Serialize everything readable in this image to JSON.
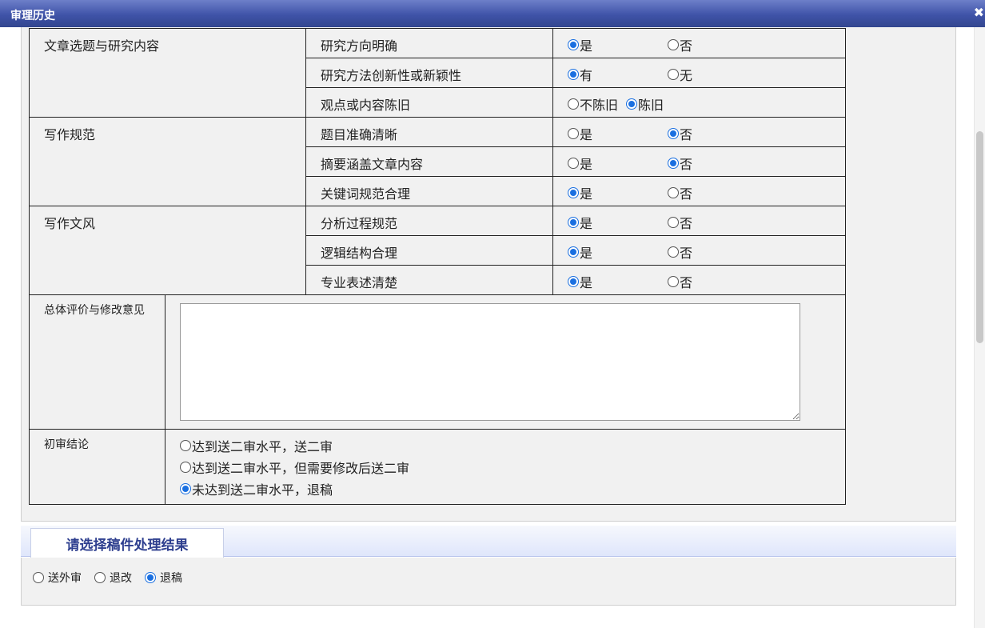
{
  "window": {
    "title": "审理历史",
    "close_glyph": "✖"
  },
  "review_table": {
    "groups": [
      {
        "category": "文章选题与研究内容",
        "rows": [
          {
            "criterion": "研究方向明确",
            "options": [
              "是",
              "否"
            ],
            "selected": 0
          },
          {
            "criterion": "研究方法创新性或新颖性",
            "options": [
              "有",
              "无"
            ],
            "selected": 0
          },
          {
            "criterion": "观点或内容陈旧",
            "options": [
              "不陈旧",
              "陈旧"
            ],
            "selected": 1
          }
        ]
      },
      {
        "category": "写作规范",
        "rows": [
          {
            "criterion": "题目准确清晰",
            "options": [
              "是",
              "否"
            ],
            "selected": 1
          },
          {
            "criterion": "摘要涵盖文章内容",
            "options": [
              "是",
              "否"
            ],
            "selected": 1
          },
          {
            "criterion": "关键词规范合理",
            "options": [
              "是",
              "否"
            ],
            "selected": 0
          }
        ]
      },
      {
        "category": "写作文风",
        "rows": [
          {
            "criterion": "分析过程规范",
            "options": [
              "是",
              "否"
            ],
            "selected": 0
          },
          {
            "criterion": "逻辑结构合理",
            "options": [
              "是",
              "否"
            ],
            "selected": 0
          },
          {
            "criterion": "专业表述清楚",
            "options": [
              "是",
              "否"
            ],
            "selected": 0
          }
        ]
      }
    ],
    "comments": {
      "label": "总体评价与修改意见",
      "value": ""
    },
    "conclusion": {
      "label": "初审结论",
      "options": [
        "达到送二审水平，送二审",
        "达到送二审水平，但需要修改后送二审",
        "未达到送二审水平，退稿"
      ],
      "selected": 2
    }
  },
  "result_section": {
    "tab_label": "请选择稿件处理结果",
    "options": [
      "送外审",
      "退改",
      "退稿"
    ],
    "selected": 2
  },
  "colors": {
    "accent": "#1a6fe0",
    "titlebar": "#3f53a8",
    "tab_text": "#2e3f8f"
  }
}
